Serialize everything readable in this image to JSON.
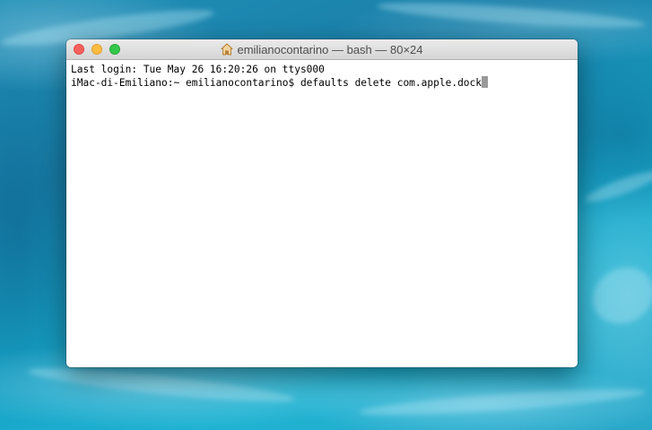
{
  "window": {
    "title": "emilianocontarino — bash — 80×24",
    "title_icon": "home-icon"
  },
  "terminal": {
    "lines": [
      "Last login: Tue May 26 16:20:26 on ttys000",
      "iMac-di-Emiliano:~ emilianocontarino$ defaults delete com.apple.dock"
    ],
    "cursor": "block"
  },
  "colors": {
    "close": "#fc605c",
    "minimize": "#fdbc40",
    "maximize": "#34c84a",
    "wallpaper": "#1a9cc0"
  }
}
